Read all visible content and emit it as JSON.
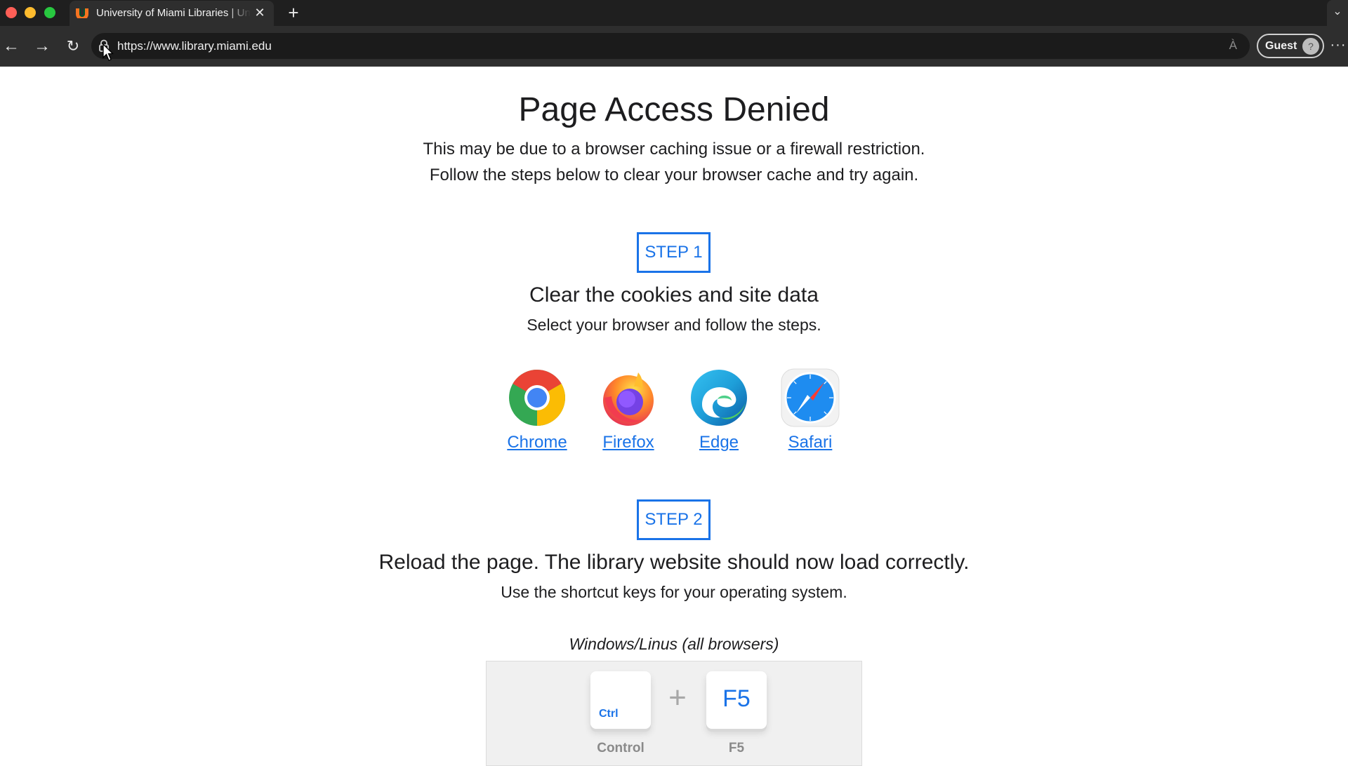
{
  "browser": {
    "tab_title": "University of Miami Libraries | University of Miami",
    "tab_close": "✕",
    "new_tab": "+",
    "url": "https://www.library.miami.edu",
    "profile_label": "Guest",
    "read_aloud": "À",
    "more": "···"
  },
  "page": {
    "title": "Page Access Denied",
    "subtitle_line1": "This may be due to a browser caching issue or a firewall restriction.",
    "subtitle_line2": "Follow the steps below to clear your browser cache and try again.",
    "step1": {
      "badge": "STEP 1",
      "heading": "Clear the cookies and site data",
      "description": "Select your browser and follow the steps.",
      "browsers": [
        {
          "label": "Chrome",
          "icon": "chrome-icon"
        },
        {
          "label": "Firefox",
          "icon": "firefox-icon"
        },
        {
          "label": "Edge",
          "icon": "edge-icon"
        },
        {
          "label": "Safari",
          "icon": "safari-icon"
        }
      ]
    },
    "step2": {
      "badge": "STEP 2",
      "heading": "Reload the page. The library website should now load correctly.",
      "description": "Use the shortcut keys for your operating system.",
      "os_label": "Windows/Linus (all browsers)",
      "keys": [
        {
          "cap": "Ctrl",
          "name": "Control"
        },
        {
          "cap": "F5",
          "name": "F5"
        }
      ],
      "plus": "+"
    }
  },
  "colors": {
    "accent": "#1a73e8",
    "chrome_bar": "#2e2e2e",
    "title_bar": "#1f1f1f"
  }
}
